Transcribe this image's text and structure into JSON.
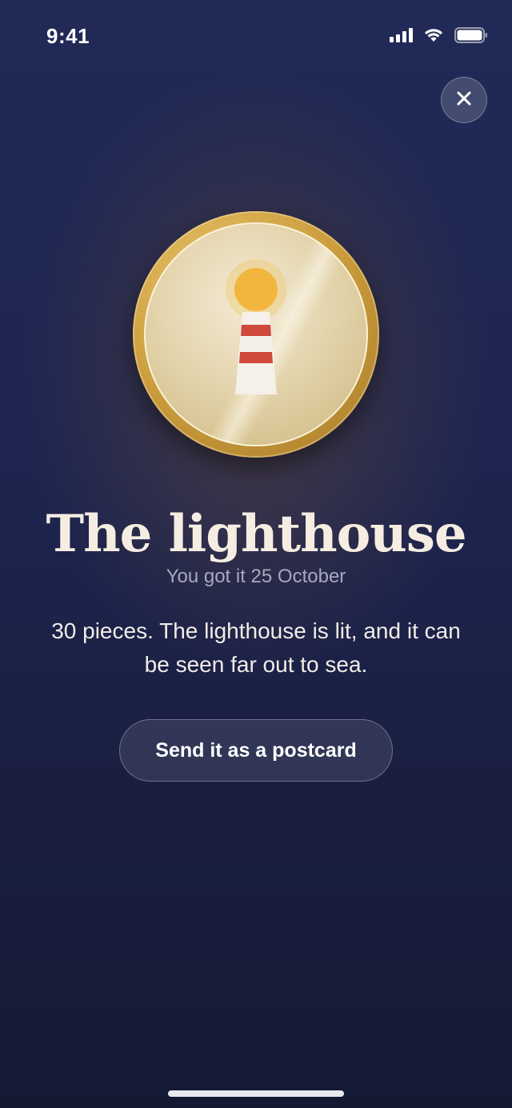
{
  "status_bar": {
    "time": "9:41"
  },
  "achievement": {
    "title": "The lighthouse",
    "earned": "You got it 25 October",
    "description": "30 pieces. The lighthouse is lit, and it can be seen far out to sea.",
    "badge_icon": "lighthouse-icon"
  },
  "actions": {
    "postcard_label": "Send it as a postcard",
    "close_icon": "close-icon"
  },
  "colors": {
    "background": "#1e2550",
    "gold": "#c99a3a",
    "light": "#f2b63e",
    "stripe": "#d0493b",
    "title": "#f6ede2"
  }
}
